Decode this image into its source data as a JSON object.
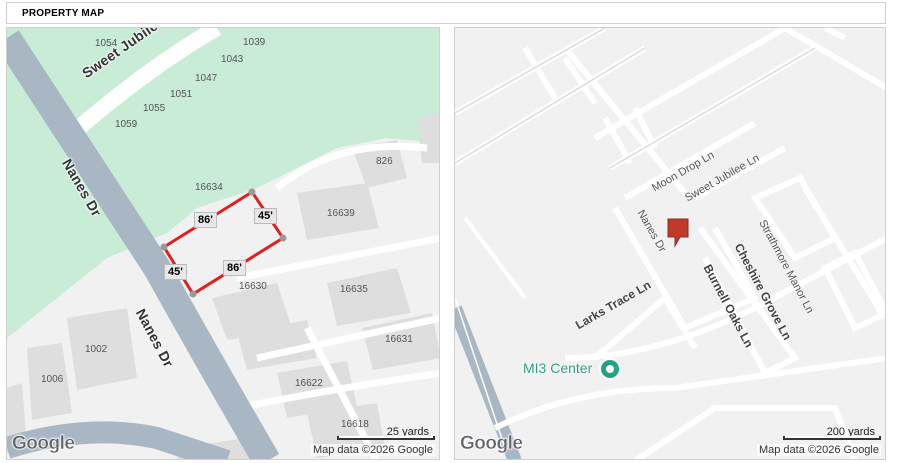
{
  "header": {
    "title": "PROPERTY MAP"
  },
  "left_map": {
    "google_logo": "Google",
    "attribution": "Map data ©2026 Google",
    "scale_label": "25 yards",
    "streets": {
      "sweet_jubilee": "Sweet Jubilee Ln",
      "nanes_upper": "Nanes Dr",
      "nanes_lower": "Nanes Dr"
    },
    "parcels": [
      "1054",
      "1039",
      "1043",
      "1047",
      "1051",
      "1055",
      "1059",
      "826",
      "16634",
      "16639",
      "16630",
      "16635",
      "16631",
      "16622",
      "16618",
      "1002",
      "1006"
    ],
    "dimensions": [
      "86'",
      "45'",
      "45'",
      "86'"
    ]
  },
  "right_map": {
    "google_logo": "Google",
    "attribution": "Map data ©2026 Google",
    "scale_label": "200 yards",
    "streets": {
      "moon_drop": "Moon Drop Ln",
      "sweet_jubilee": "Sweet Jubilee Ln",
      "nanes": "Nanes Dr",
      "strathmore": "Strathmore Manor Ln",
      "cheshire": "Cheshire Grove Ln",
      "burnell": "Burnell Oaks Ln",
      "larks": "Larks Trace Ln"
    },
    "poi": {
      "label": "MI3 Center",
      "icon": "place-pin-icon"
    },
    "marker": {
      "icon": "property-marker-icon",
      "color": "#c0392b"
    }
  },
  "colors": {
    "park": "#c8ecd5",
    "road": "#a9b7c4",
    "road_minor": "#ffffff",
    "building": "#dedede",
    "parcel_outline": "#e02020"
  }
}
